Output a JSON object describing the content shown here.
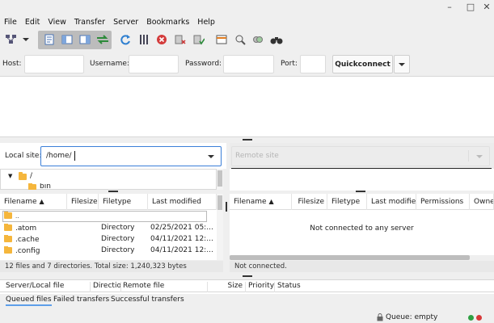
{
  "window_controls": {
    "minimize": "–",
    "maximize": "□",
    "close": "✕"
  },
  "menu": [
    "File",
    "Edit",
    "View",
    "Transfer",
    "Server",
    "Bookmarks",
    "Help"
  ],
  "quickconnect": {
    "host_label": "Host:",
    "username_label": "Username:",
    "password_label": "Password:",
    "port_label": "Port:",
    "button_label": "Quickconnect"
  },
  "local": {
    "site_label": "Local site:",
    "site_path": "/home/",
    "tree": [
      "/",
      "bin"
    ],
    "columns": [
      "Filename",
      "Filesize",
      "Filetype",
      "Last modified"
    ],
    "rows": [
      {
        "name": "..",
        "size": "",
        "type": "",
        "modified": ""
      },
      {
        "name": ".atom",
        "size": "",
        "type": "Directory",
        "modified": "02/25/2021 05:..."
      },
      {
        "name": ".cache",
        "size": "",
        "type": "Directory",
        "modified": "04/11/2021 12:..."
      },
      {
        "name": ".config",
        "size": "",
        "type": "Directory",
        "modified": "04/11/2021 12:..."
      }
    ],
    "status": "12 files and 7 directories. Total size: 1,240,323 bytes"
  },
  "remote": {
    "site_placeholder": "Remote site",
    "columns": [
      "Filename",
      "Filesize",
      "Filetype",
      "Last modified",
      "Permissions",
      "Owne"
    ],
    "empty_message": "Not connected to any server",
    "status": "Not connected."
  },
  "queue": {
    "columns": [
      "Server/Local file",
      "Directio",
      "Remote file",
      "Size",
      "Priority",
      "Status"
    ],
    "tabs": [
      "Queued files",
      "Failed transfers",
      "Successful transfers"
    ],
    "status": "Queue: empty"
  },
  "colors": {
    "accent": "#3b7fd8",
    "folder": "#f5b63c",
    "led_green": "#2ea043",
    "led_red": "#d73a3a"
  }
}
